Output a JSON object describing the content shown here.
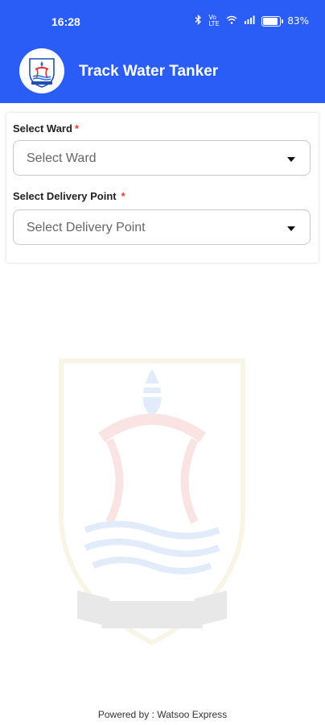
{
  "status_bar": {
    "time": "16:28",
    "icons": [
      "bluetooth-icon",
      "wifi-icon",
      "signal-icon",
      "battery-icon"
    ],
    "network_text": "Vo LTE",
    "battery_percent": "83%",
    "battery_level": 0.83
  },
  "header": {
    "title": "Track Water Tanker",
    "logo_icon": "delhi-jal-board-logo-icon",
    "background_color": "#2a5cf6"
  },
  "form": {
    "ward": {
      "label": "Select Ward",
      "required_mark": "*",
      "placeholder": "Select Ward"
    },
    "delivery_point": {
      "label": "Select Delivery Point",
      "required_mark": "*",
      "placeholder": "Select Delivery Point"
    }
  },
  "watermark": {
    "icon": "delhi-jal-board-emblem-watermark"
  },
  "footer": {
    "text": "Powered by : Watsoo Express"
  }
}
